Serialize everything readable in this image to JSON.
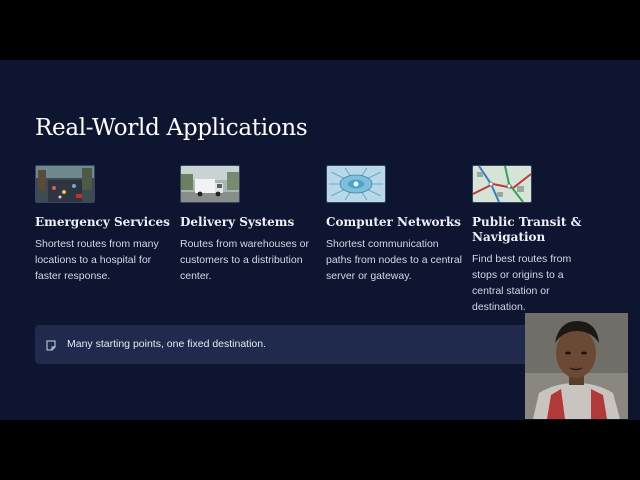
{
  "slide": {
    "title": "Real-World Applications",
    "cards": [
      {
        "title": "Emergency Services",
        "desc": "Shortest routes from many locations to a hospital for faster response.",
        "image": "city-traffic-photo"
      },
      {
        "title": "Delivery Systems",
        "desc": "Routes from warehouses or customers to a distribution center.",
        "image": "delivery-truck-photo"
      },
      {
        "title": "Computer Networks",
        "desc": "Shortest communication paths from nodes to a central server or gateway.",
        "image": "network-hub-illustration"
      },
      {
        "title": "Public Transit & Navigation",
        "desc": "Find best routes from stops or origins to a central station or destination.",
        "image": "transit-map-illustration"
      }
    ],
    "callout": {
      "icon": "note-icon",
      "text": "Many starting points, one fixed destination."
    }
  },
  "webcam": {
    "label": "presenter-webcam"
  },
  "colors": {
    "slide_bg": "#0d1530",
    "letterbox": "#000000",
    "callout_bg": "#1f2a4c",
    "text": "#ffffff"
  }
}
